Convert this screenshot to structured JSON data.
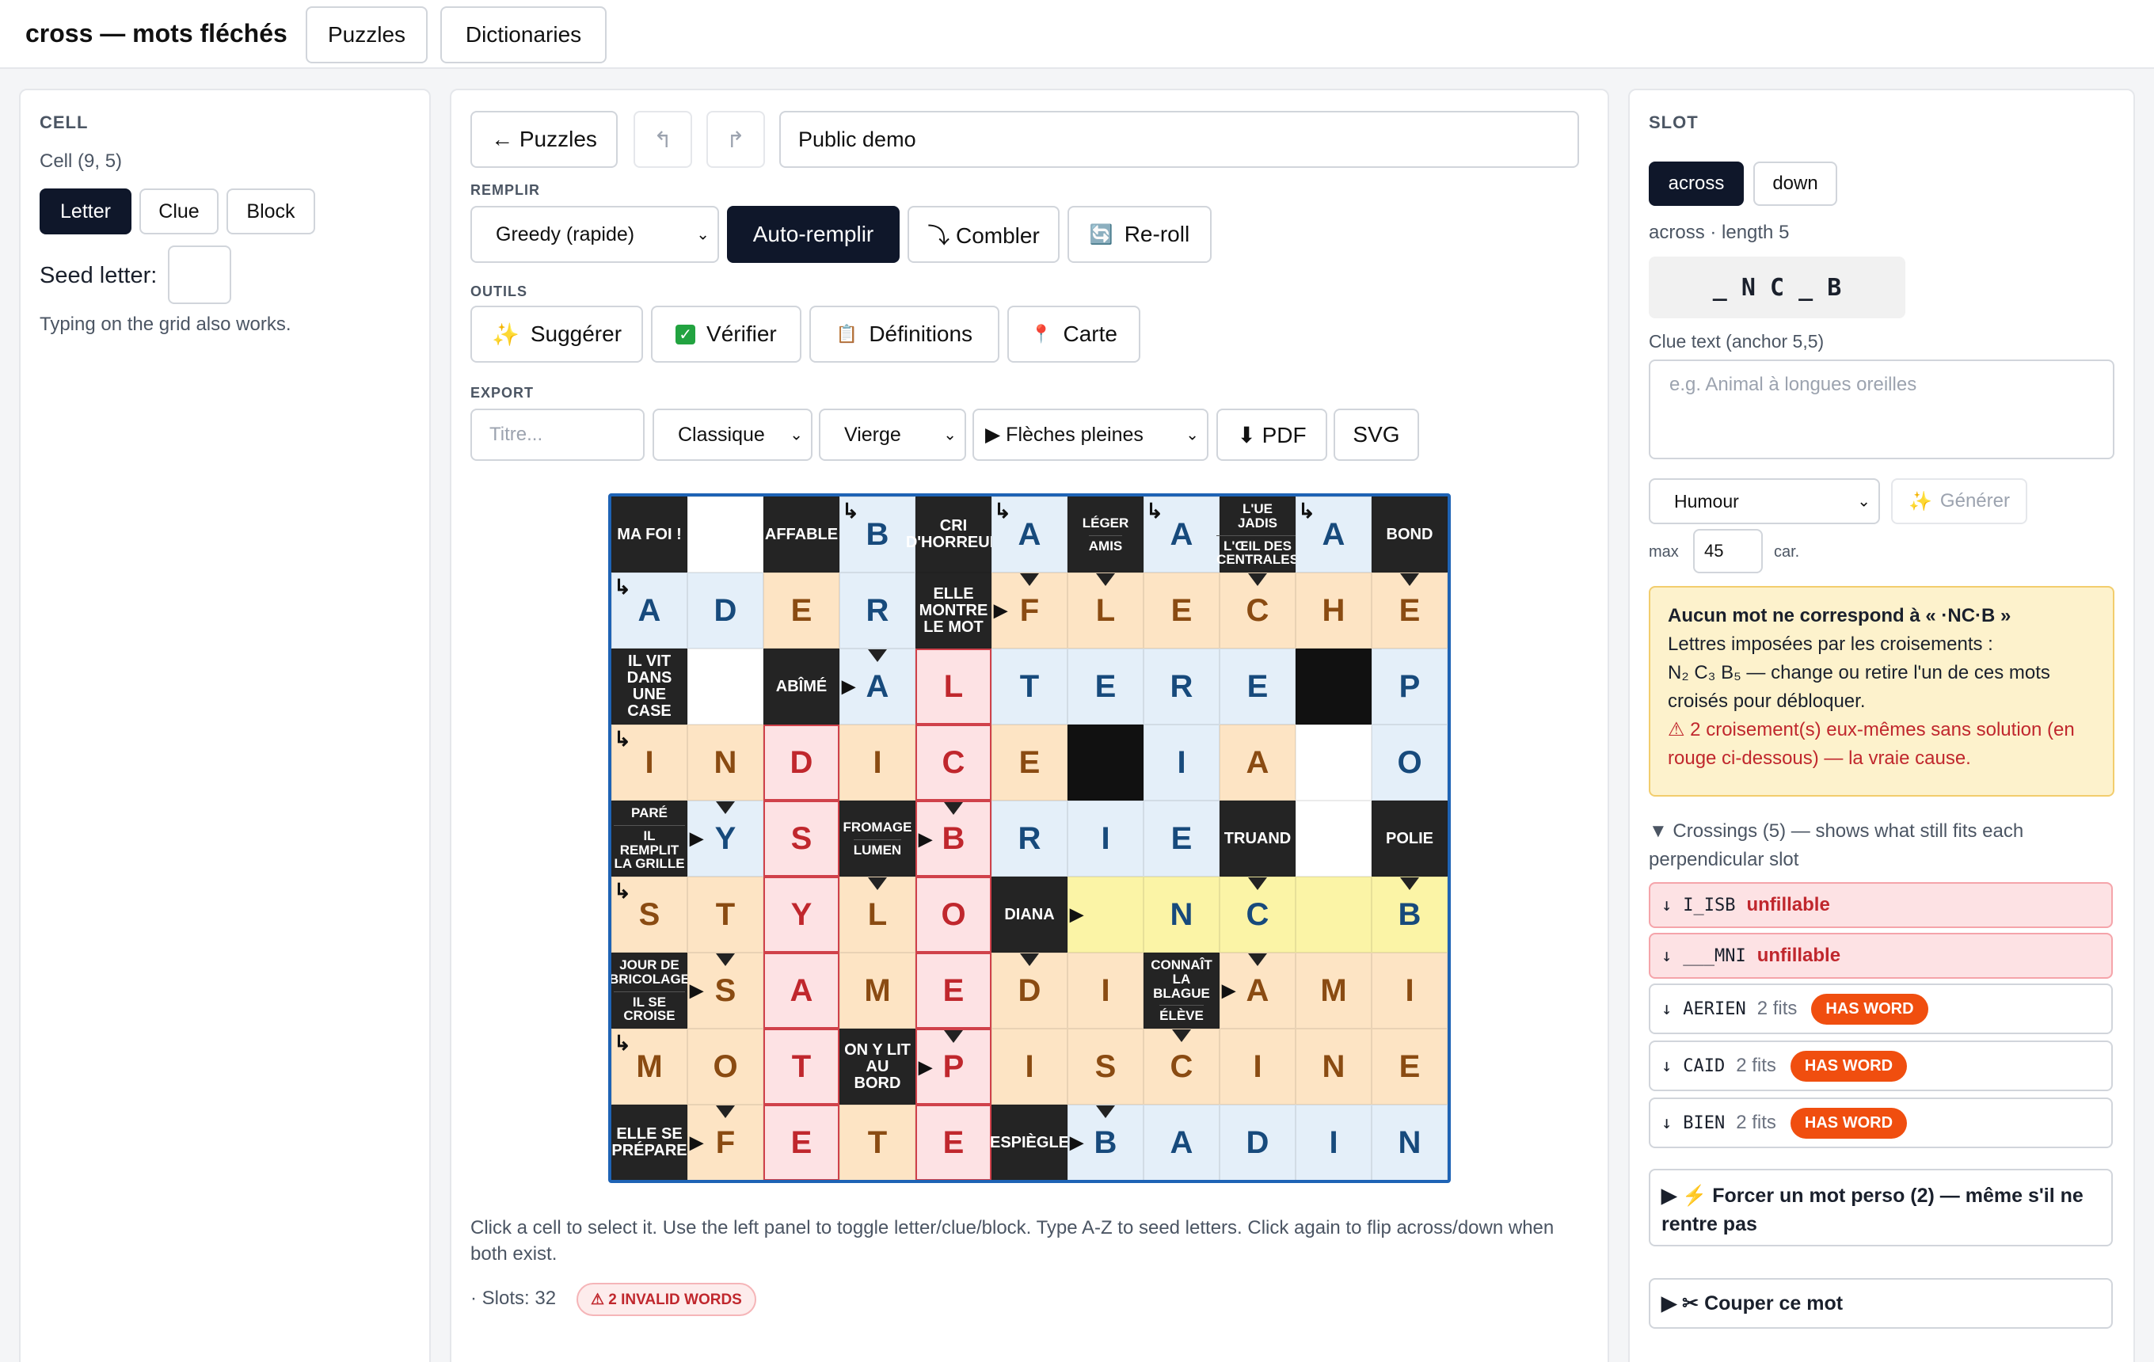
{
  "app": {
    "title": "cross — mots fléchés",
    "nav": [
      "Puzzles",
      "Dictionaries"
    ]
  },
  "left": {
    "heading": "CELL",
    "cell_label": "Cell (9, 5)",
    "modes": [
      "Letter",
      "Clue",
      "Block"
    ],
    "seed_label": "Seed letter:",
    "hint": "Typing on the grid also works."
  },
  "center": {
    "back": "← Puzzles",
    "undo": "↰",
    "redo": "↱",
    "puzzle_name": "Public demo",
    "remplir_heading": "REMPLIR",
    "fill_mode": "Greedy (rapide)",
    "auto": "Auto-remplir",
    "combler": "⤵ Combler",
    "reroll": "Re-roll",
    "outils_heading": "OUTILS",
    "suggerer": "Suggérer",
    "verifier": "Vérifier",
    "definitions": "Définitions",
    "carte": "Carte",
    "export_heading": "EXPORT",
    "title_placeholder": "Titre...",
    "style": "Classique",
    "vierge": "Vierge",
    "fleches": "▶ Flèches pleines",
    "pdf": "⬇ PDF",
    "svg": "SVG",
    "help": "Click a cell to select it. Use the left panel to toggle letter/clue/block. Type A-Z to seed letters. Click again to flip across/down when both exist.",
    "slots": "· Slots: 32",
    "invalid": "⚠ 2 INVALID WORDS",
    "clues": [
      "MA FOI !",
      "AFFABLE",
      "CRI D'HORREUR",
      "LÉGER",
      "AMIS",
      "L'UE JADIS",
      "L'ŒIL DES CENTRALES",
      "BOND",
      "ELLE MONTRE LE MOT",
      "IL VIT DANS UNE CASE",
      "ABÎMÉ",
      "PARÉ",
      "IL REMPLIT LA GRILLE",
      "FROMAGE",
      "LUMEN",
      "TRUAND",
      "POLIE",
      "DIANA",
      "JOUR DE BRICOLAGE",
      "IL SE CROISE",
      "CONNAÎT LA BLAGUE",
      "ÉLÈVE",
      "ON Y LIT AU BORD",
      "ELLE SE PRÉPARE",
      "ESPIÈGLE"
    ],
    "rows": [
      [
        "",
        "",
        "",
        "B",
        "",
        "A",
        "",
        "A",
        "",
        "A",
        ""
      ],
      [
        "A",
        "D",
        "E",
        "R",
        "",
        "F",
        "L",
        "E",
        "C",
        "H",
        "E"
      ],
      [
        "",
        "",
        "",
        "A",
        "L",
        "T",
        "E",
        "R",
        "E",
        "",
        "P"
      ],
      [
        "I",
        "N",
        "D",
        "I",
        "C",
        "E",
        "",
        "I",
        "A",
        "",
        "O"
      ],
      [
        "",
        "Y",
        "S",
        "",
        "B",
        "R",
        "I",
        "E",
        "",
        "",
        "",
        ""
      ],
      [
        "S",
        "T",
        "Y",
        "L",
        "O",
        "",
        "",
        "N",
        "C",
        "",
        "B"
      ],
      [
        "",
        "S",
        "A",
        "M",
        "E",
        "D",
        "I",
        "",
        "A",
        "M",
        "I"
      ],
      [
        "M",
        "O",
        "T",
        "",
        "P",
        "I",
        "S",
        "C",
        "I",
        "N",
        "E"
      ],
      [
        "",
        "F",
        "E",
        "T",
        "E",
        "",
        "B",
        "A",
        "D",
        "I",
        "N"
      ]
    ]
  },
  "right": {
    "heading": "SLOT",
    "dirs": [
      "across",
      "down"
    ],
    "meta": "across · length 5",
    "pattern": "_ N C _ B",
    "clue_label": "Clue text (anchor 5,5)",
    "clue_placeholder": "e.g. Animal à longues oreilles",
    "tone": "Humour",
    "generate": "Générer",
    "max_label": "max",
    "max_value": "45",
    "car": "car.",
    "warn_title": "Aucun mot ne correspond à « ·NC·B »",
    "warn_l1": "Lettres imposées par les croisements :",
    "warn_l2": "N₂ C₃ B₅ — change ou retire l'un de ces mots croisés pour débloquer.",
    "warn_l3": "⚠ 2 croisement(s) eux-mêmes sans solution (en rouge ci-dessous) — la vraie cause.",
    "crossings_title": "▼ Crossings (5) — shows what still fits each perpendicular slot",
    "crossings": [
      {
        "arrow": "↓",
        "word": "I_ISB",
        "status": "unfillable"
      },
      {
        "arrow": "↓",
        "word": "___MNI",
        "status": "unfillable"
      },
      {
        "arrow": "↓",
        "word": "AERIEN",
        "fits": "2 fits",
        "badge": "HAS WORD"
      },
      {
        "arrow": "↓",
        "word": "CAID",
        "fits": "2 fits",
        "badge": "HAS WORD"
      },
      {
        "arrow": "↓",
        "word": "BIEN",
        "fits": "2 fits",
        "badge": "HAS WORD"
      }
    ],
    "force": "▶ ⚡ Forcer un mot perso (2) — même s'il ne rentre pas",
    "cut": "▶ ✂ Couper ce mot"
  }
}
